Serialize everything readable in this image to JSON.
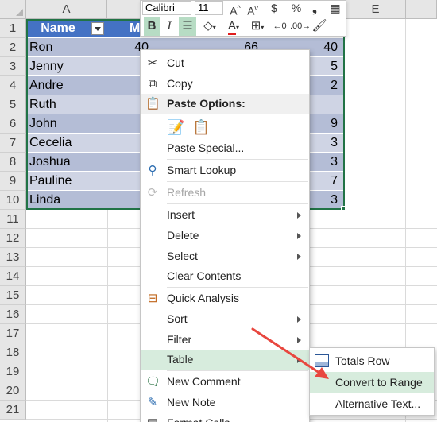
{
  "columns": [
    {
      "id": "A",
      "label": "A"
    },
    {
      "id": "E",
      "label": "E"
    }
  ],
  "rows": [
    "1",
    "2",
    "3",
    "4",
    "5",
    "6",
    "7",
    "8",
    "9",
    "10",
    "11",
    "12",
    "13",
    "14",
    "15",
    "16",
    "17",
    "18",
    "19",
    "20",
    "21"
  ],
  "table": {
    "header": {
      "name": "Name",
      "second": "M"
    },
    "records": [
      {
        "name": "Ron",
        "b": "40",
        "c": "66",
        "d": "40"
      },
      {
        "name": "Jenny",
        "b": "",
        "c": "",
        "d": "5"
      },
      {
        "name": "Andre",
        "b": "",
        "c": "",
        "d": "2"
      },
      {
        "name": "Ruth",
        "b": "",
        "c": "",
        "d": ""
      },
      {
        "name": "John",
        "b": "",
        "c": "",
        "d": "9"
      },
      {
        "name": "Cecelia",
        "b": "",
        "c": "",
        "d": "3"
      },
      {
        "name": "Joshua",
        "b": "",
        "c": "",
        "d": "3"
      },
      {
        "name": "Pauline",
        "b": "",
        "c": "",
        "d": "7"
      },
      {
        "name": "Linda",
        "b": "",
        "c": "",
        "d": "3"
      }
    ]
  },
  "mini_toolbar": {
    "font": "Calibri",
    "size": "11",
    "bold": "B",
    "italic": "I",
    "grow": "A",
    "shrink": "A",
    "currency": "$",
    "percent": "%",
    "comma": "9",
    "font_color_letter": "A"
  },
  "context_menu": {
    "cut": "Cut",
    "copy": "Copy",
    "paste_options": "Paste Options:",
    "paste_special": "Paste Special...",
    "smart_lookup": "Smart Lookup",
    "refresh": "Refresh",
    "insert": "Insert",
    "delete": "Delete",
    "select": "Select",
    "clear_contents": "Clear Contents",
    "quick_analysis": "Quick Analysis",
    "sort": "Sort",
    "filter": "Filter",
    "table": "Table",
    "new_comment": "New Comment",
    "new_note": "New Note",
    "format_cells": "Format Cells..."
  },
  "table_submenu": {
    "totals_row": "Totals Row",
    "convert_to_range": "Convert to Range",
    "alternative_text": "Alternative Text..."
  },
  "colors": {
    "accent": "#217346",
    "table_header": "#4472c4",
    "band_dark": "#b4bdd6",
    "band_light": "#cfd4e4",
    "highlight": "#d7ecdd",
    "annotation_arrow": "#e8473f"
  }
}
